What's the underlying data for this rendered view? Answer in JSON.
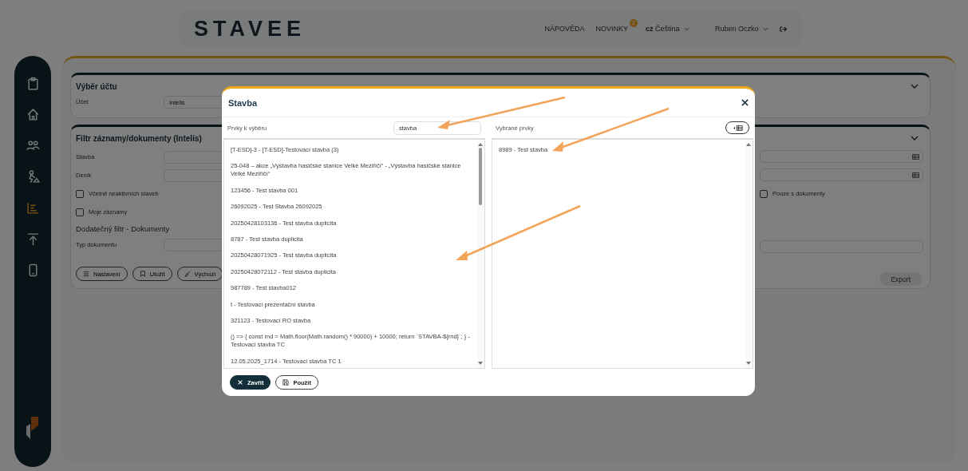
{
  "header": {
    "logo": "STAVEE",
    "help": "NÁPOVĚDA",
    "news": {
      "label": "NOVINKY",
      "badge": "2"
    },
    "language": {
      "code": "cz",
      "label": "Čeština"
    },
    "user": "Ruben Oczko"
  },
  "sidebar": {
    "items": [
      {
        "selected": false
      },
      {
        "selected": false
      },
      {
        "selected": false
      },
      {
        "selected": false
      },
      {
        "selected": true
      },
      {
        "selected": false
      },
      {
        "selected": false
      }
    ]
  },
  "account_card": {
    "title": "Výběr účtu",
    "field": {
      "label": "Účet",
      "value": "Intelis"
    }
  },
  "filter_card": {
    "title": "Filtr záznamy/dokumenty (Intelis)",
    "fields": [
      {
        "label": "Stavba"
      },
      {
        "label": "Deník"
      }
    ],
    "checkboxes": [
      {
        "label": "Včetně neaktivních staveb",
        "checked": false
      },
      {
        "label": "Moje záznamy",
        "checked": false
      }
    ],
    "subheading": "Dodatečný filtr - Dokumenty",
    "doc_field": {
      "label": "Typ dokumentu"
    },
    "buttons": [
      {
        "label": "Nastavení"
      },
      {
        "label": "Uložit"
      },
      {
        "label": "Výchozí"
      }
    ],
    "right_checkbox": {
      "label": "Pouze s dokumenty",
      "checked": false
    },
    "export": {
      "label": "Export",
      "disabled": true
    }
  },
  "dialog": {
    "title": "Stavba",
    "available": {
      "label": "Prvky k výběru",
      "search": "stavba",
      "items": [
        "[T-ESD]-3 - [T-ESD]-Testovací stavba (3)",
        "25-048 – akce „Výstavba hasičské stanice Velké Meziříčí“ - „Výstavba hasičské stanice Velké Meziříčí“",
        "123456 - Test stavba 001",
        "26092025 - Test Stavba 26092025",
        "20250428103136 - Test stavba duplicita",
        "8787 - Test stavba duplicita",
        "20250428071925 - Test stavba duplicita",
        "20250428072112 - Test stavba duplicita",
        "987789 - Test stavba012",
        "t - Testovací prezentační stavba",
        "321123 - Testovací RO stavba",
        "() => { const rnd = Math.floor(Math.random() * 90000) + 10000; return `STAVBA-${rnd}`; } - Testovací stavba TC",
        "12.05.2025_1714 - Testovaci stavba TC 1"
      ]
    },
    "selected": {
      "label": "Vybrané prvky",
      "items": [
        "8989 - Test stavba"
      ]
    },
    "buttons": [
      {
        "label": "Zavřít",
        "kind": "primary"
      },
      {
        "label": "Použít",
        "kind": "secondary"
      }
    ]
  }
}
